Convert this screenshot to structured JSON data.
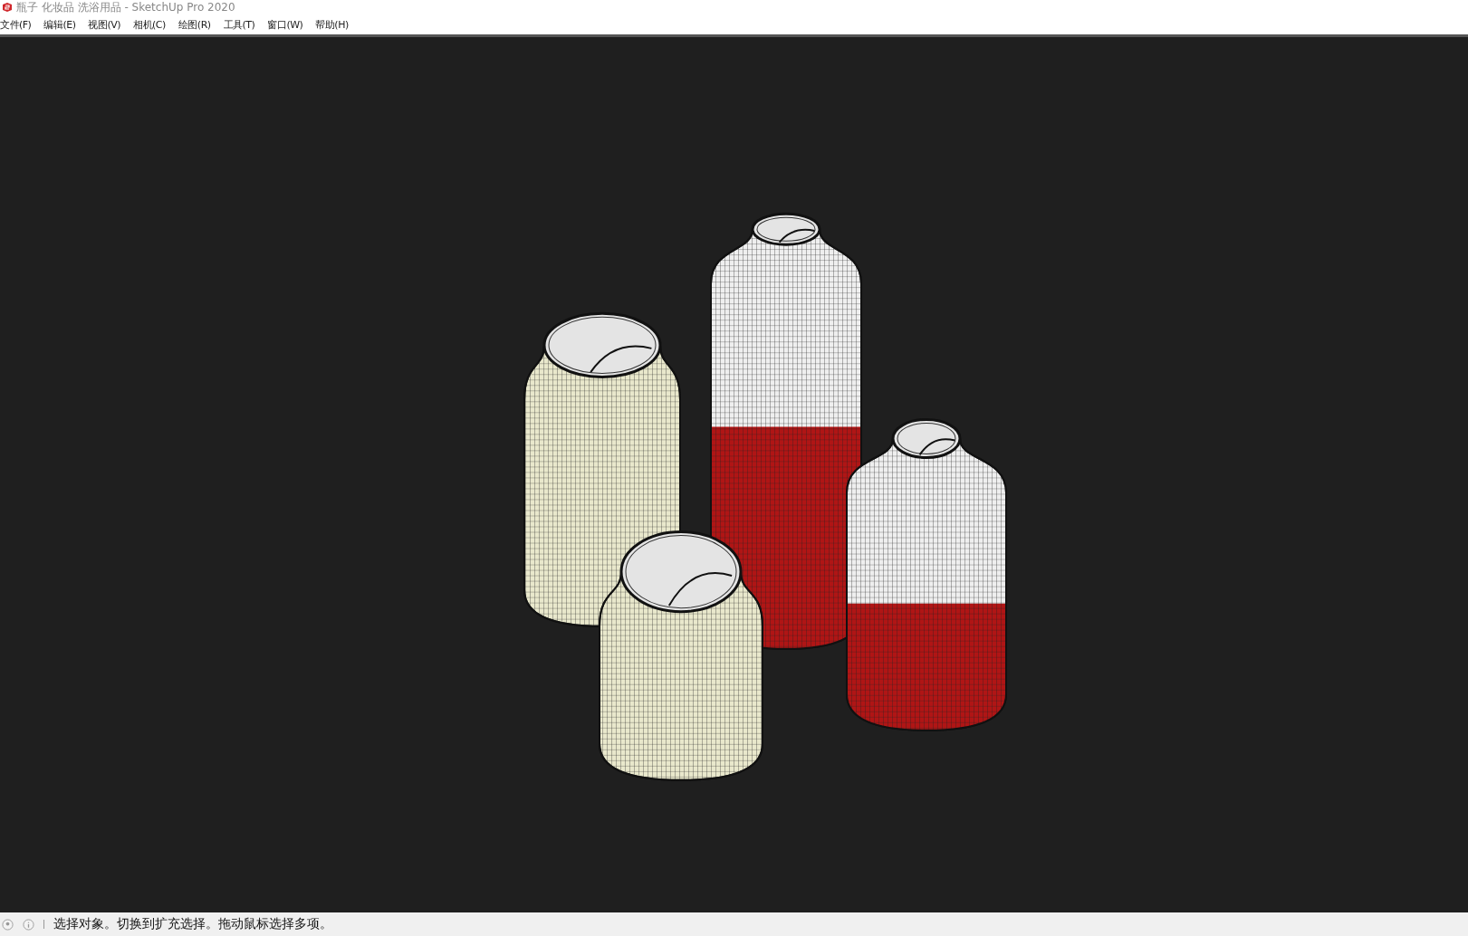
{
  "window": {
    "title": "瓶子 化妆品 洗浴用品 - SketchUp Pro 2020"
  },
  "menu": [
    "文件(F)",
    "编辑(E)",
    "视图(V)",
    "相机(C)",
    "绘图(R)",
    "工具(T)",
    "窗口(W)",
    "帮助(H)"
  ],
  "status_bar": {
    "message": "选择对象。切换到扩充选择。拖动鼠标选择多项。"
  }
}
